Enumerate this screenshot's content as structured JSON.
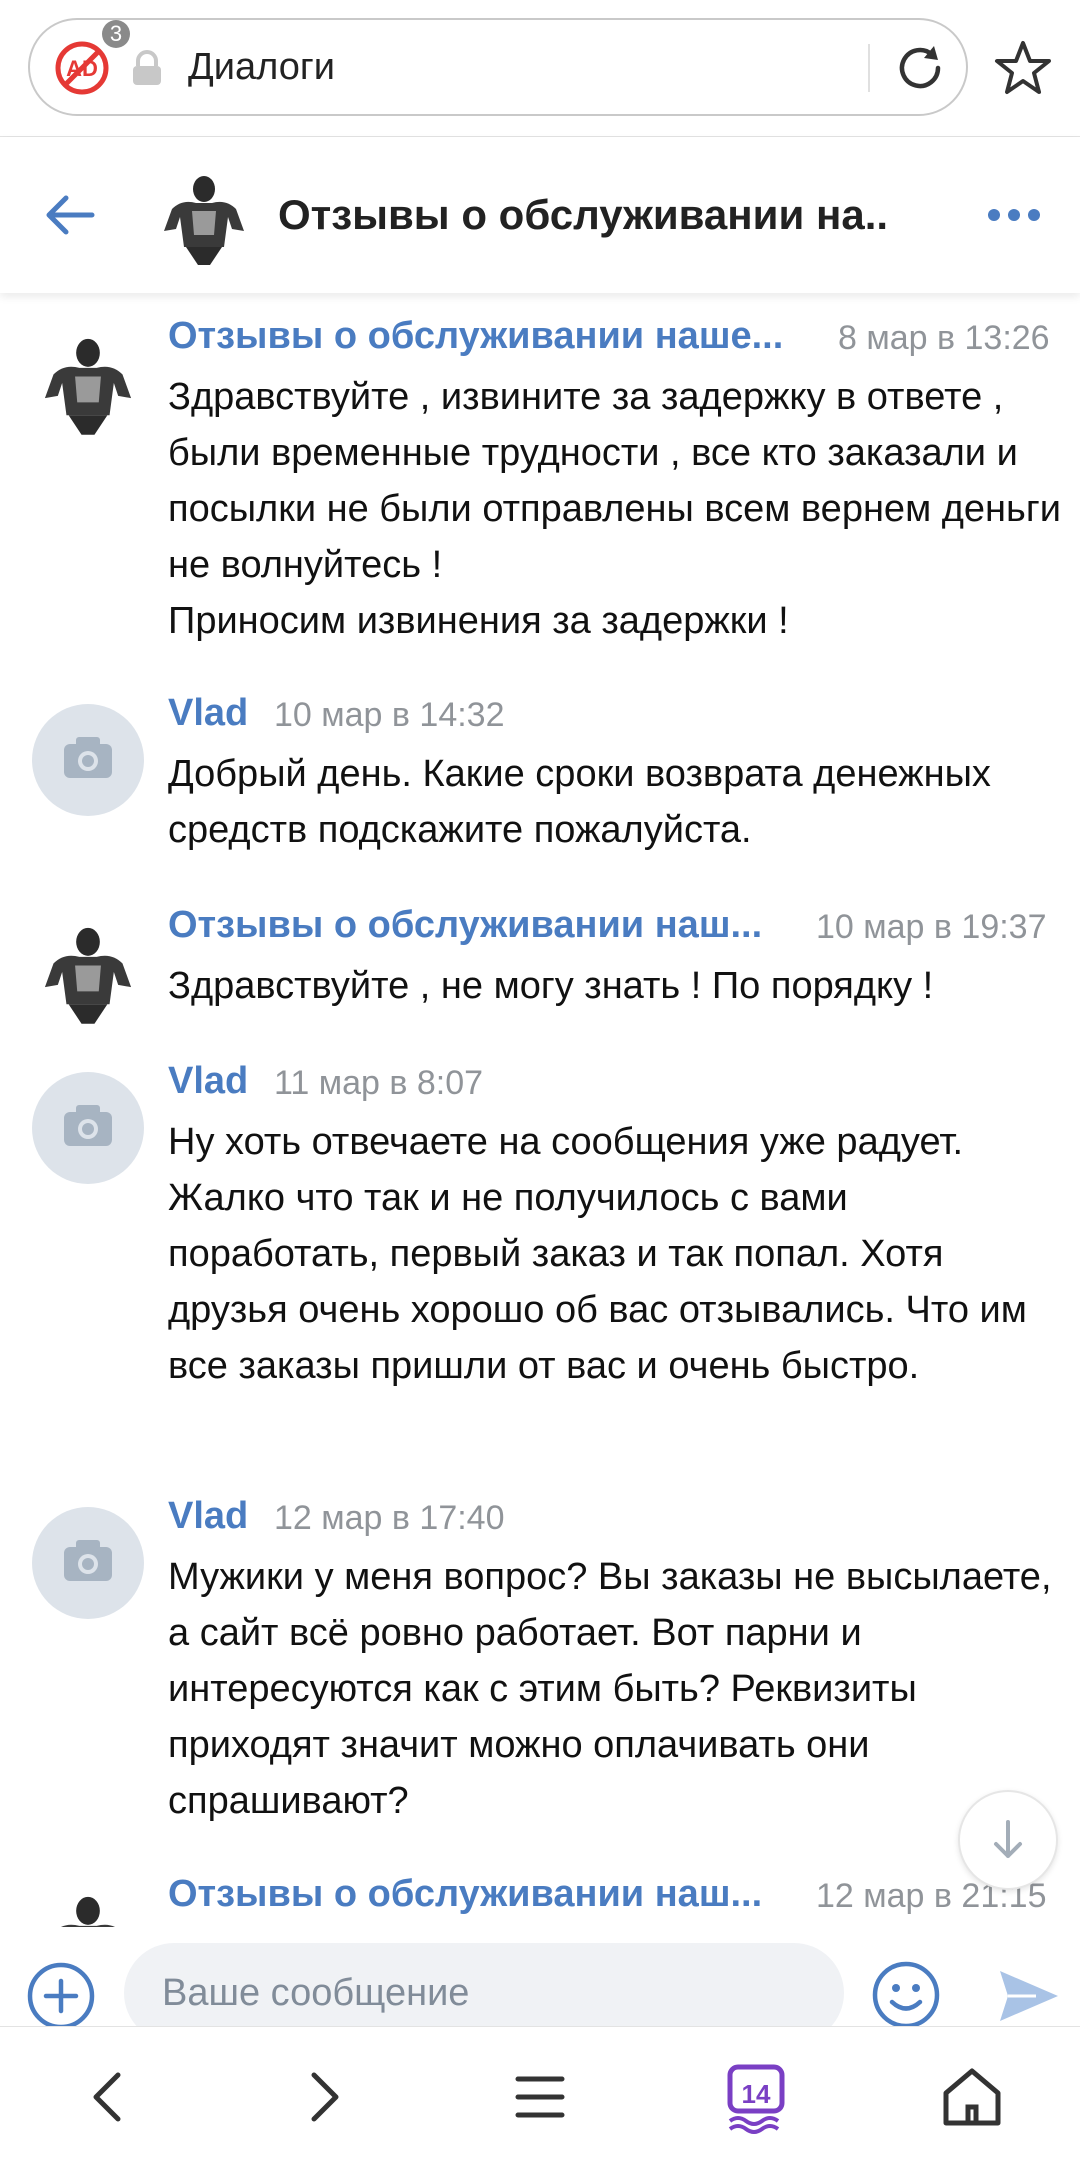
{
  "browser": {
    "adblock_count": "3",
    "url_text": "Диалоги"
  },
  "header": {
    "title": "Отзывы о обслуживании на.."
  },
  "messages": [
    {
      "author": "Отзывы о обслуживании наше...",
      "time": "8 мар в 13:26",
      "avatar": "bodybuilder-avatar",
      "text": "Здравствуйте , извините за задержку в ответе , были временные трудности , все кто заказали и посылки не были отправлены всем вернем деньги не волнуйтесь !\nПриносим извинения за задержки !"
    },
    {
      "author": "Vlad",
      "time": "10 мар в 14:32",
      "avatar": "camera-placeholder-avatar",
      "text": "Добрый день. Какие сроки возврата денежных средств подскажите пожалуйста."
    },
    {
      "author": "Отзывы о обслуживании наш...",
      "time": "10 мар в 19:37",
      "avatar": "bodybuilder-avatar",
      "text": "Здравствуйте , не могу знать ! По порядку !"
    },
    {
      "author": "Vlad",
      "time": "11 мар в 8:07",
      "avatar": "camera-placeholder-avatar",
      "text": "Ну хоть отвечаете на сообщения уже радует. Жалко что так и не получилось с вами поработать, первый заказ и так попал. Хотя друзья очень хорошо об вас отзывались. Что им все заказы пришли от вас и очень быстро."
    },
    {
      "author": "Vlad",
      "time": "12 мар в 17:40",
      "avatar": "camera-placeholder-avatar",
      "text": "Мужики у меня вопрос? Вы заказы не высылаете, а сайт всё ровно работает. Вот парни и интересуются как с этим быть? Реквизиты приходят значит можно оплачивать они спрашивают?"
    },
    {
      "author": "Отзывы о обслуживании наш...",
      "time": "12 мар в 21:15",
      "avatar": "bodybuilder-avatar",
      "text": ""
    }
  ],
  "composer": {
    "placeholder": "Ваше сообщение"
  },
  "nav": {
    "tabs_count": "14"
  },
  "colors": {
    "accent": "#4a7cc1",
    "name_link": "#4a7cc1",
    "time_gray": "#909499",
    "input_bg": "#f0f2f5",
    "tabs_purple": "#7a3fc4",
    "adblock_red": "#e53935"
  }
}
